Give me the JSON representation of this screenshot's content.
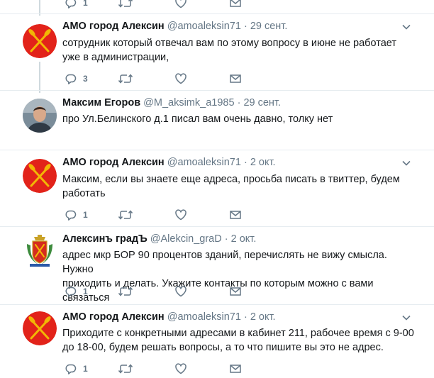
{
  "top_actions": {
    "reply_count": "1"
  },
  "tweets": [
    {
      "name": "АМО город Алексин",
      "handle": "@amoaleksin71",
      "sep": "·",
      "date": "29 сент.",
      "line1": "сотрудник который отвечал вам по этому вопросу в июне  не работает",
      "line2": "уже в администрации,",
      "reply_count": "3"
    },
    {
      "name": "Максим Егоров",
      "handle": "@M_aksimk_a1985",
      "sep": "·",
      "date": "29 сент.",
      "line1": "про Ул.Белинского д.1 писал вам очень давно, толку нет",
      "line2": "",
      "reply_count": ""
    },
    {
      "name": "АМО город Алексин",
      "handle": "@amoaleksin71",
      "sep": "·",
      "date": "2 окт.",
      "line1": "Максим, если вы знаете еще адреса, просьба писать в твиттер, будем",
      "line2": "работать",
      "reply_count": "1"
    },
    {
      "name": "Алексинъ градЪ",
      "handle": "@Alekcin_graD",
      "sep": "·",
      "date": "2 окт.",
      "line1": "адрес мкр БОР 90 процентов зданий, перечислять не вижу смысла. Нужно",
      "line2": "приходить и делать. Укажите контакты по которым можно с вами связаться",
      "reply_count": "1"
    },
    {
      "name": "АМО город Алексин",
      "handle": "@amoaleksin71",
      "sep": "·",
      "date": "2 окт.",
      "line1": "Приходите с конкретными адресами в кабинет 211, рабочее время с 9-00",
      "line2": "до 18-00,  будем решать вопросы, а то что пишите вы это не адрес.",
      "reply_count": "1"
    }
  ],
  "colors": {
    "icon_gray": "#657786",
    "divider": "#e6ecf0",
    "thread_line": "#cfd9de",
    "logo_red": "#e2231a",
    "logo_gold": "#f2b705"
  }
}
